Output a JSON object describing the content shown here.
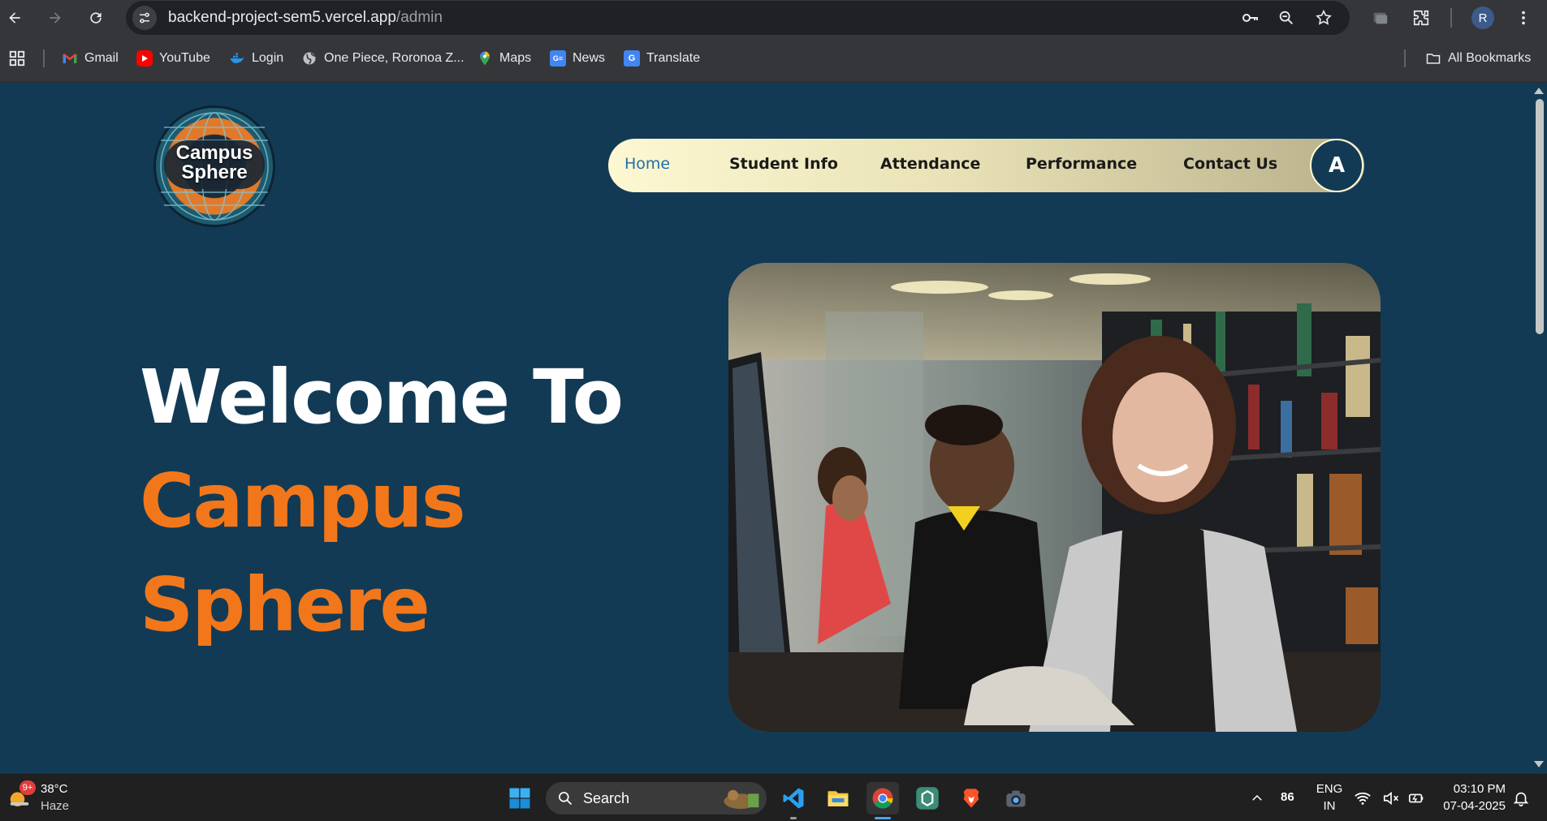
{
  "browser": {
    "url_host": "backend-project-sem5.vercel.app",
    "url_path": "/admin",
    "profile_initial": "R"
  },
  "bookmarks": {
    "items": [
      {
        "label": "Gmail",
        "icon": "gmail-icon"
      },
      {
        "label": "YouTube",
        "icon": "youtube-icon"
      },
      {
        "label": "Login",
        "icon": "docker-icon"
      },
      {
        "label": "One Piece, Roronoa Z...",
        "icon": "globe-icon"
      },
      {
        "label": "Maps",
        "icon": "maps-icon"
      },
      {
        "label": "News",
        "icon": "news-icon"
      },
      {
        "label": "Translate",
        "icon": "translate-icon"
      }
    ],
    "all_bookmarks": "All Bookmarks"
  },
  "site": {
    "logo_line1": "Campus",
    "logo_line2": "Sphere",
    "nav": [
      "Home",
      "Student Info",
      "Attendance",
      "Performance",
      "Contact Us"
    ],
    "active_nav": "Home",
    "avatar_initial": "A",
    "hero_line1": "Welcome To",
    "hero_line2": "Campus",
    "hero_line3": "Sphere",
    "accent_color": "#f2771a",
    "background_color": "#123a55"
  },
  "taskbar": {
    "weather_temp": "38°C",
    "weather_desc": "Haze",
    "weather_badge": "9+",
    "search_placeholder": "Search",
    "tray_number": "86",
    "lang_line1": "ENG",
    "lang_line2": "IN",
    "time": "03:10 PM",
    "date": "07-04-2025"
  }
}
